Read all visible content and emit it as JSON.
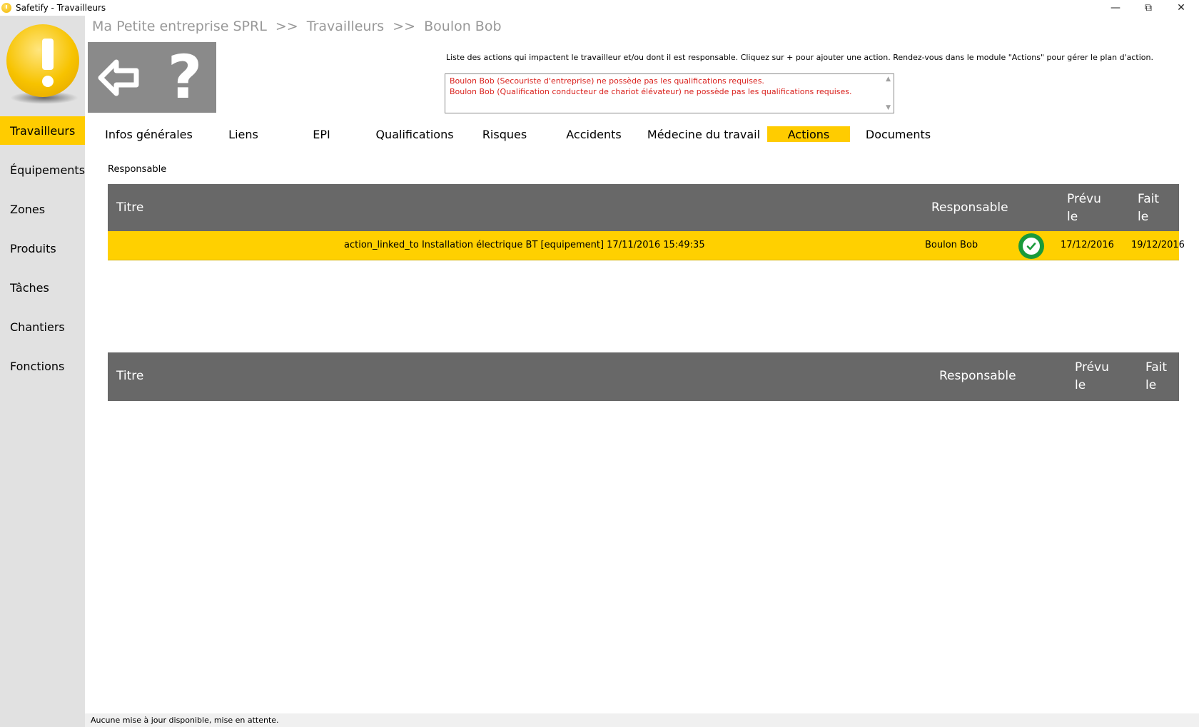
{
  "window": {
    "title": "Safetify - Travailleurs",
    "min_icon": "minimize-icon",
    "max_icon": "restore-icon",
    "close_icon": "close-icon"
  },
  "sidebar": {
    "logo_icon": "exclamation-logo-icon",
    "items": [
      {
        "label": "Travailleurs",
        "active": true
      },
      {
        "label": "Équipements"
      },
      {
        "label": "Zones"
      },
      {
        "label": "Produits"
      },
      {
        "label": "Tâches"
      },
      {
        "label": "Chantiers"
      },
      {
        "label": "Fonctions"
      }
    ]
  },
  "breadcrumb": {
    "company": "Ma Petite entreprise SPRL",
    "section": "Travailleurs",
    "worker": "Boulon Bob",
    "separator": ">>"
  },
  "toolbar": {
    "back_icon": "back-arrow-icon",
    "help_label": "?"
  },
  "info_text": "Liste des actions qui impactent le travailleur et/ou dont il est responsable. Cliquez sur + pour ajouter une action. Rendez-vous dans le module \"Actions\" pour gérer le plan d'action.",
  "warnings": [
    "Boulon Bob (Secouriste d'entreprise) ne possède pas les qualifications requises.",
    "Boulon Bob (Qualification conducteur de chariot élévateur) ne possède pas les qualifications requises."
  ],
  "tabs": [
    {
      "label": "Infos générales"
    },
    {
      "label": "Liens"
    },
    {
      "label": "EPI"
    },
    {
      "label": "Qualifications"
    },
    {
      "label": "Risques"
    },
    {
      "label": "Accidents"
    },
    {
      "label": "Médecine du travail"
    },
    {
      "label": "Actions",
      "active": true
    },
    {
      "label": "Documents"
    }
  ],
  "section_label": "Responsable",
  "table1": {
    "headers": {
      "title": "Titre",
      "responsible": "Responsable",
      "planned_1": "Prévu",
      "planned_2": "le",
      "done_1": "Fait",
      "done_2": "le"
    },
    "rows": [
      {
        "title": "action_linked_to Installation électrique BT [equipement]  17/11/2016 15:49:35",
        "responsible": "Boulon Bob",
        "status_icon": "check-circle-icon",
        "planned": "17/12/2016",
        "done": "19/12/2016"
      }
    ]
  },
  "table2": {
    "headers": {
      "title": "Titre",
      "responsible": "Responsable",
      "planned_1": "Prévu",
      "planned_2": "le",
      "done_1": "Fait",
      "done_2": "le"
    },
    "rows": []
  },
  "status_bar": "Aucune mise à jour disponible, mise en attente.",
  "colors": {
    "accent": "#ffcc00",
    "sidebar_bg": "#e1e1e1",
    "header_bg": "#686868",
    "warning_text": "#d9211d",
    "done_green": "#1a9a3a"
  }
}
